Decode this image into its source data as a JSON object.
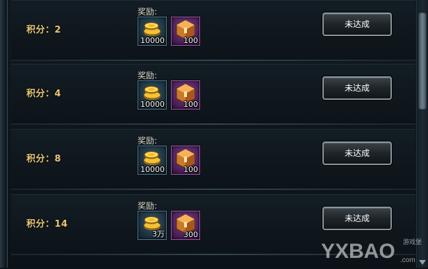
{
  "rows": [
    {
      "score": "积分：2",
      "reward_label": "奖励:",
      "gold_qty": "10000",
      "box_qty": "100",
      "status": "未达成"
    },
    {
      "score": "积分：4",
      "reward_label": "奖励:",
      "gold_qty": "10000",
      "box_qty": "100",
      "status": "未达成"
    },
    {
      "score": "积分：8",
      "reward_label": "奖励:",
      "gold_qty": "10000",
      "box_qty": "100",
      "status": "未达成"
    },
    {
      "score": "积分：14",
      "reward_label": "奖励:",
      "gold_qty": "3万",
      "box_qty": "300",
      "status": "未达成"
    }
  ],
  "icons": {
    "gold": "gold-coins-icon",
    "box": "treasure-box-icon"
  },
  "watermark": {
    "text": "YXBAO",
    "sub": "游戏堡",
    "domain": ".com"
  }
}
